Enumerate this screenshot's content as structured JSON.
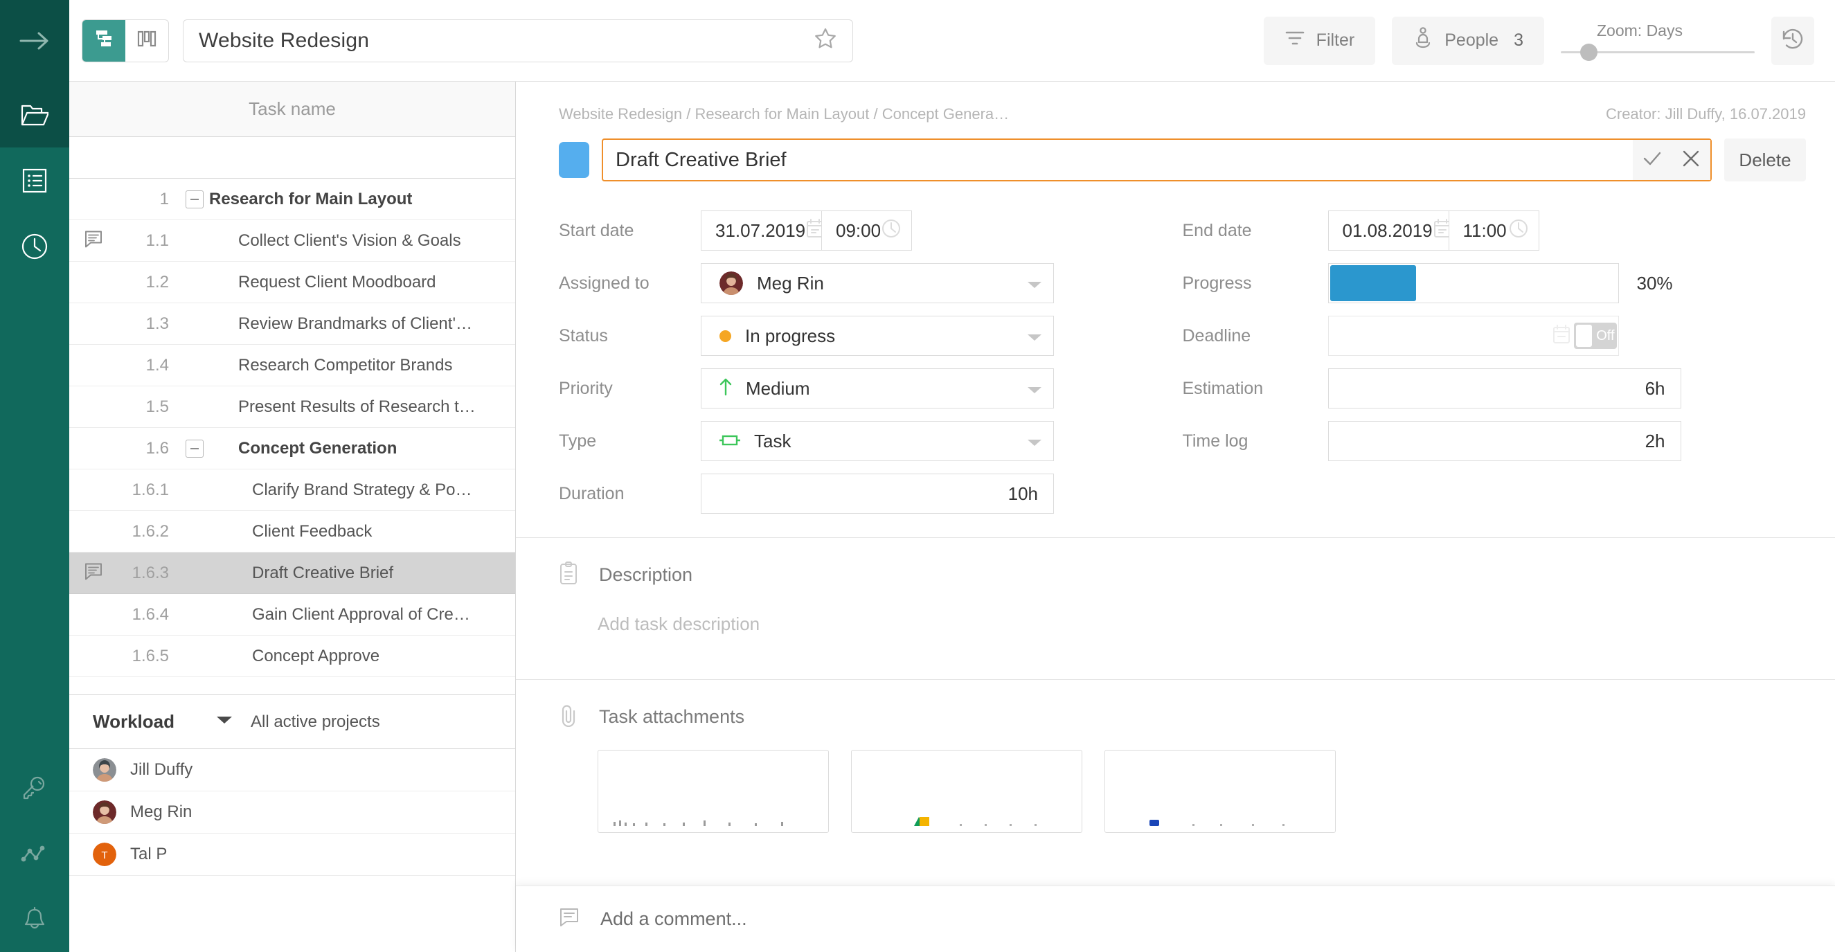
{
  "rail": {
    "collapse_icon": "arrow-right-icon",
    "items": [
      {
        "name": "projects",
        "icon": "folder-icon",
        "active": true
      },
      {
        "name": "tasks",
        "icon": "list-icon",
        "active": false
      },
      {
        "name": "time",
        "icon": "clock-icon",
        "active": false
      }
    ],
    "bottom_items": [
      {
        "name": "permissions",
        "icon": "key-icon"
      },
      {
        "name": "reports",
        "icon": "chart-line-icon"
      },
      {
        "name": "notifications",
        "icon": "bell-icon"
      }
    ]
  },
  "topbar": {
    "view_gantt": "gantt-icon",
    "view_board": "board-icon",
    "project_title": "Website Redesign",
    "star_icon": "star-icon",
    "filter_label": "Filter",
    "people_label": "People",
    "people_count": "3",
    "zoom_label": "Zoom: Days",
    "history_icon": "history-icon"
  },
  "tasks_panel": {
    "column_header": "Task name",
    "rows": [
      {
        "wbs": "1",
        "name": "Research for Main Layout",
        "level": 0,
        "group": true,
        "toggle": true,
        "comment": false,
        "selected": false
      },
      {
        "wbs": "1.1",
        "name": "Collect Client's Vision & Goals",
        "level": 1,
        "group": false,
        "toggle": false,
        "comment": true,
        "selected": false
      },
      {
        "wbs": "1.2",
        "name": "Request Client Moodboard",
        "level": 1,
        "group": false,
        "toggle": false,
        "comment": false,
        "selected": false
      },
      {
        "wbs": "1.3",
        "name": "Review Brandmarks of Client'…",
        "level": 1,
        "group": false,
        "toggle": false,
        "comment": false,
        "selected": false
      },
      {
        "wbs": "1.4",
        "name": "Research Competitor Brands",
        "level": 1,
        "group": false,
        "toggle": false,
        "comment": false,
        "selected": false
      },
      {
        "wbs": "1.5",
        "name": "Present Results of Research t…",
        "level": 1,
        "group": false,
        "toggle": false,
        "comment": false,
        "selected": false
      },
      {
        "wbs": "1.6",
        "name": "Concept Generation",
        "level": 1,
        "group": true,
        "toggle": true,
        "comment": false,
        "selected": false
      },
      {
        "wbs": "1.6.1",
        "name": "Clarify Brand Strategy & Po…",
        "level": 2,
        "group": false,
        "toggle": false,
        "comment": false,
        "selected": false
      },
      {
        "wbs": "1.6.2",
        "name": "Client Feedback",
        "level": 2,
        "group": false,
        "toggle": false,
        "comment": false,
        "selected": false
      },
      {
        "wbs": "1.6.3",
        "name": "Draft Creative Brief",
        "level": 2,
        "group": false,
        "toggle": false,
        "comment": true,
        "selected": true
      },
      {
        "wbs": "1.6.4",
        "name": "Gain Client Approval of Cre…",
        "level": 2,
        "group": false,
        "toggle": false,
        "comment": false,
        "selected": false
      },
      {
        "wbs": "1.6.5",
        "name": "Concept Approve",
        "level": 2,
        "group": false,
        "toggle": false,
        "comment": false,
        "selected": false
      }
    ],
    "workload": {
      "title": "Workload",
      "scope": "All active projects",
      "people": [
        {
          "name": "Jill Duffy",
          "avatar_type": "photo",
          "color": "#8b8f93"
        },
        {
          "name": "Meg Rin",
          "avatar_type": "photo",
          "color": "#6d2a2a"
        },
        {
          "name": "Tal P",
          "avatar_type": "initial",
          "initial": "T",
          "color": "#e2620c"
        }
      ]
    }
  },
  "detail": {
    "breadcrumb": "Website Redesign / Research for Main Layout / Concept Genera…",
    "creator": "Creator: Jill Duffy, 16.07.2019",
    "task_color": "#55AEEE",
    "task_title": "Draft Creative Brief",
    "confirm_icon": "check-icon",
    "cancel_icon": "close-icon",
    "delete_label": "Delete",
    "fields": {
      "start_date_label": "Start date",
      "start_date_value": "31.07.2019",
      "start_time_value": "09:00",
      "end_date_label": "End date",
      "end_date_value": "01.08.2019",
      "end_time_value": "11:00",
      "assigned_label": "Assigned to",
      "assigned_value": "Meg Rin",
      "progress_label": "Progress",
      "progress_value": "30%",
      "progress_percent": 30,
      "progress_color": "#2B97CE",
      "status_label": "Status",
      "status_value": "In progress",
      "status_color": "#F5A623",
      "deadline_label": "Deadline",
      "deadline_value": "",
      "deadline_toggle": "Off",
      "priority_label": "Priority",
      "priority_value": "Medium",
      "priority_color": "#3CC65A",
      "estimation_label": "Estimation",
      "estimation_value": "6h",
      "type_label": "Type",
      "type_value": "Task",
      "type_color": "#3CC65A",
      "timelog_label": "Time log",
      "timelog_value": "2h",
      "duration_label": "Duration",
      "duration_value": "10h"
    },
    "description": {
      "title": "Description",
      "icon": "clipboard-icon",
      "placeholder": "Add task description"
    },
    "attachments": {
      "title": "Task attachments",
      "icon": "paperclip-icon",
      "cards": [
        "attachment-1",
        "attachment-2",
        "attachment-3"
      ]
    },
    "comment": {
      "icon": "comment-icon",
      "placeholder": "Add a comment..."
    }
  }
}
